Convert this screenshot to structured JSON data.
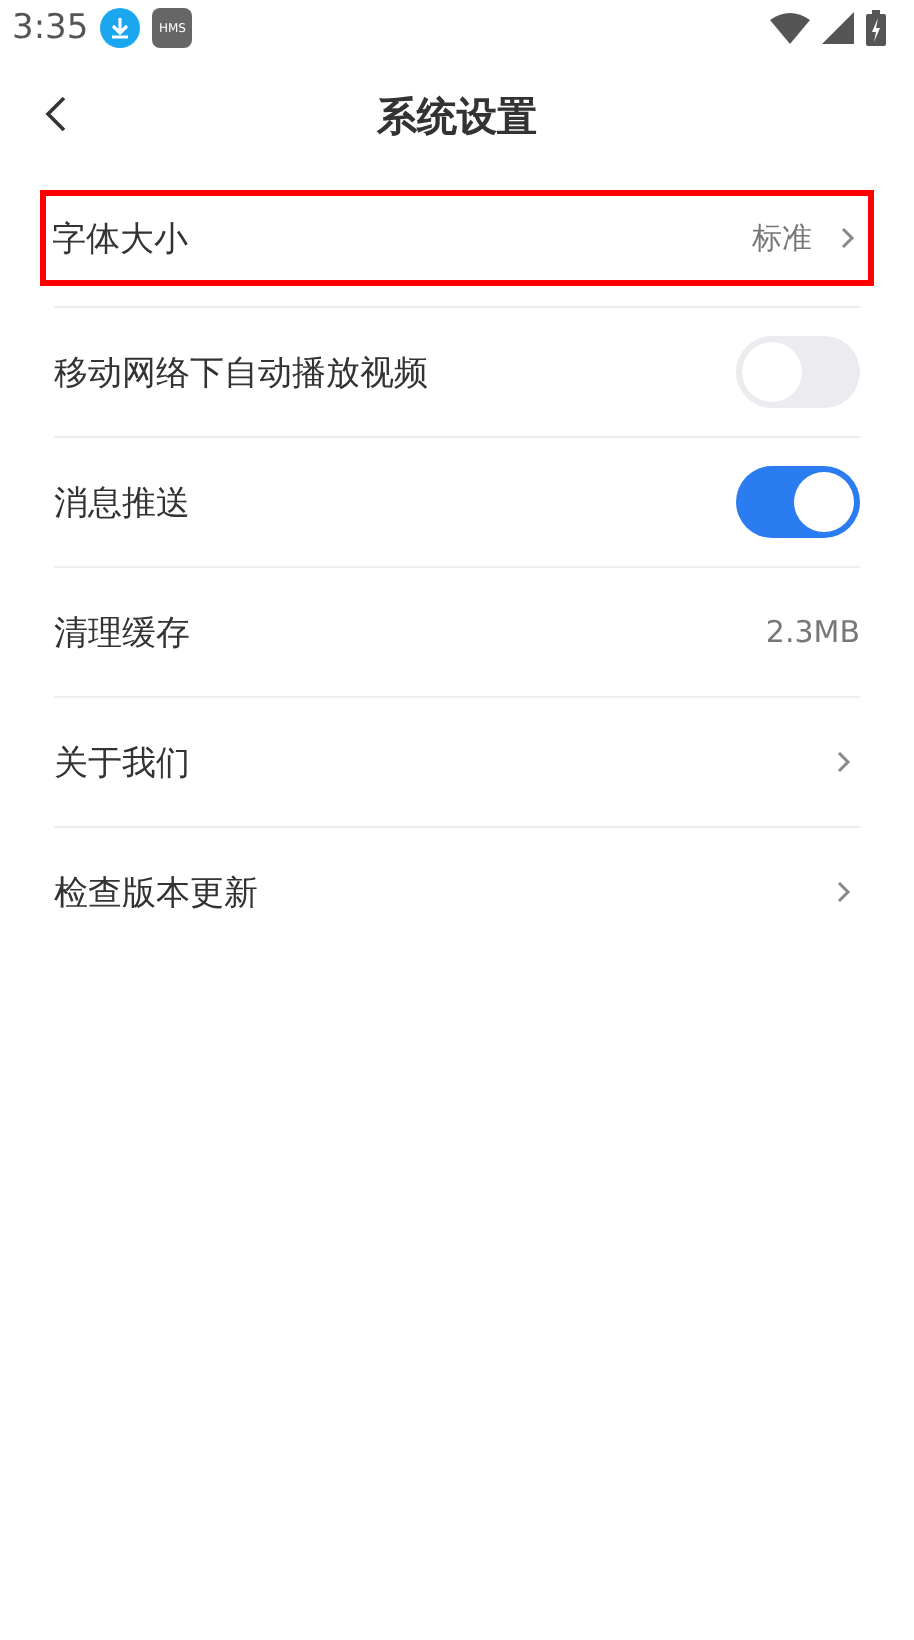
{
  "status_bar": {
    "time": "3:35",
    "badge": "HMS"
  },
  "header": {
    "title": "系统设置"
  },
  "rows": [
    {
      "kind": "link",
      "label": "字体大小",
      "value": "标准",
      "highlighted": true
    },
    {
      "kind": "toggle",
      "label": "移动网络下自动播放视频",
      "on": false
    },
    {
      "kind": "toggle",
      "label": "消息推送",
      "on": true
    },
    {
      "kind": "value",
      "label": "清理缓存",
      "value": "2.3MB"
    },
    {
      "kind": "link",
      "label": "关于我们"
    },
    {
      "kind": "link",
      "label": "检查版本更新"
    }
  ]
}
